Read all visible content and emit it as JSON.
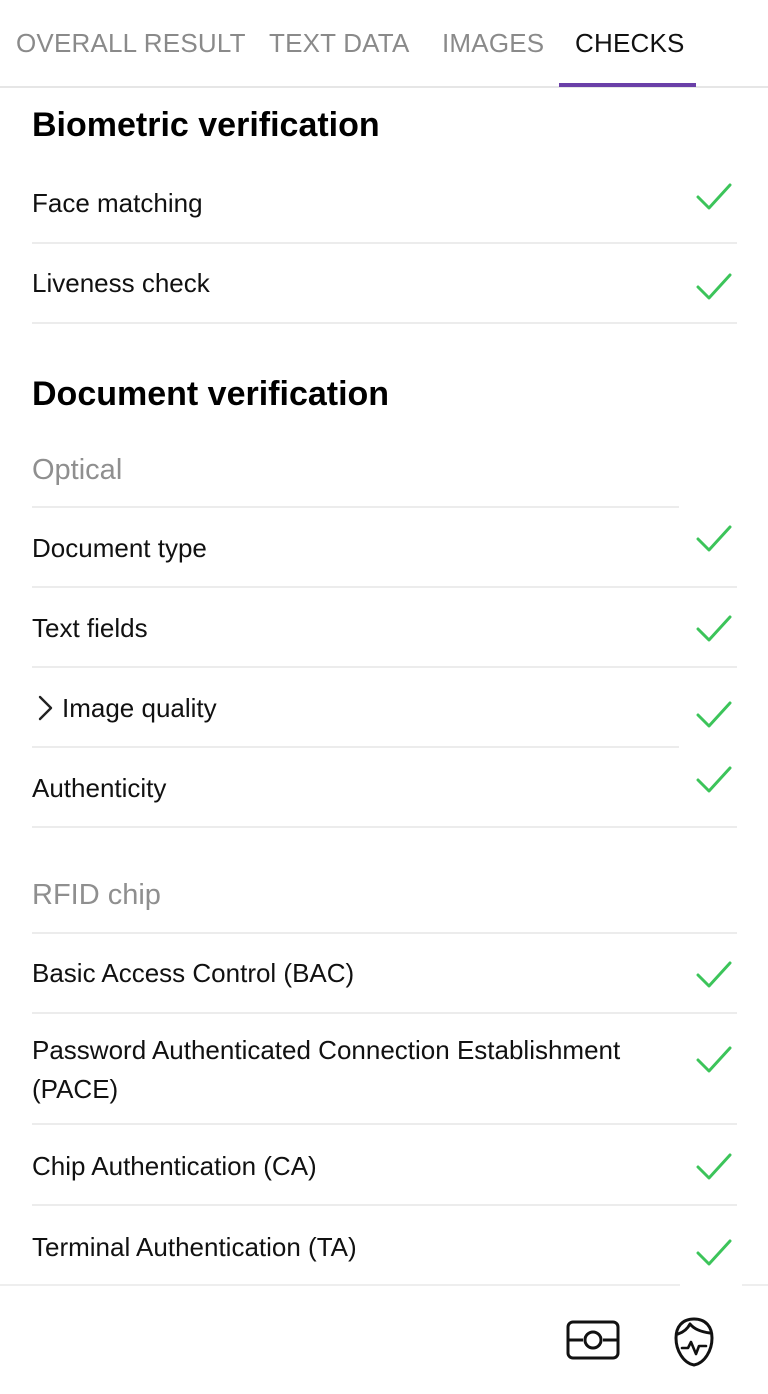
{
  "tabs": [
    {
      "label": "OVERALL RESULT"
    },
    {
      "label": "TEXT DATA"
    },
    {
      "label": "IMAGES"
    },
    {
      "label": "CHECKS",
      "active": true
    }
  ],
  "biometric": {
    "title": "Biometric verification",
    "items": [
      {
        "label": "Face matching",
        "status": "passed"
      },
      {
        "label": "Liveness check",
        "status": "passed"
      }
    ]
  },
  "document": {
    "title": "Document verification",
    "optical": {
      "title": "Optical",
      "items": [
        {
          "label": "Document type",
          "status": "passed"
        },
        {
          "label": "Text fields",
          "status": "passed"
        },
        {
          "label": "Image quality",
          "status": "passed",
          "expandable": true
        },
        {
          "label": "Authenticity",
          "status": "passed"
        }
      ]
    },
    "rfid": {
      "title": "RFID chip",
      "items": [
        {
          "label": "Basic Access Control (BAC)",
          "status": "passed"
        },
        {
          "label": "Password Authenticated Connection Establishment",
          "label_line2": "(PACE)",
          "status": "passed"
        },
        {
          "label": "Chip Authentication (CA)",
          "status": "passed"
        },
        {
          "label": "Terminal Authentication (TA)",
          "status": "passed"
        }
      ]
    }
  },
  "bottom_bar": {
    "icons": [
      "document-scan-icon",
      "face-liveness-icon"
    ]
  },
  "colors": {
    "accent": "#6a3fa8",
    "check": "#3cc45a",
    "muted": "#8a8a8a"
  }
}
